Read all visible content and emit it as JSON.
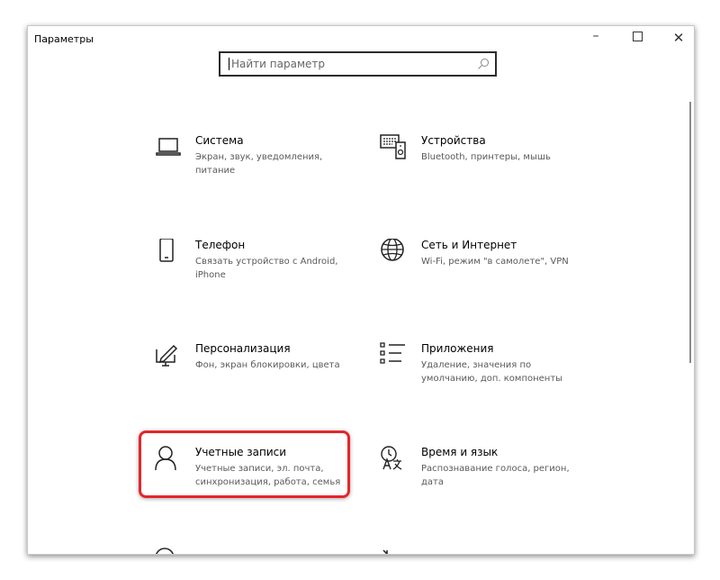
{
  "window": {
    "title": "Параметры",
    "minimize": "–",
    "close": "✕"
  },
  "search": {
    "placeholder": "Найти параметр"
  },
  "tiles": [
    {
      "title": "Система",
      "desc": "Экран, звук, уведомления, питание",
      "icon": "laptop-icon"
    },
    {
      "title": "Устройства",
      "desc": "Bluetooth, принтеры, мышь",
      "icon": "devices-icon"
    },
    {
      "title": "Телефон",
      "desc": "Связать устройство с Android, iPhone",
      "icon": "phone-icon"
    },
    {
      "title": "Сеть и Интернет",
      "desc": "Wi-Fi, режим \"в самолете\", VPN",
      "icon": "globe-icon"
    },
    {
      "title": "Персонализация",
      "desc": "Фон, экран блокировки, цвета",
      "icon": "personalization-icon"
    },
    {
      "title": "Приложения",
      "desc": "Удаление, значения по умолчанию, доп. компоненты",
      "icon": "apps-list-icon"
    },
    {
      "title": "Учетные записи",
      "desc": "Учетные записи, эл. почта, синхронизация, работа, семья",
      "icon": "person-icon"
    },
    {
      "title": "Время и язык",
      "desc": "Распознавание голоса, регион, дата",
      "icon": "time-language-icon"
    }
  ],
  "colors": {
    "highlight": "#e3262b",
    "text_secondary": "#5a5a5a"
  }
}
